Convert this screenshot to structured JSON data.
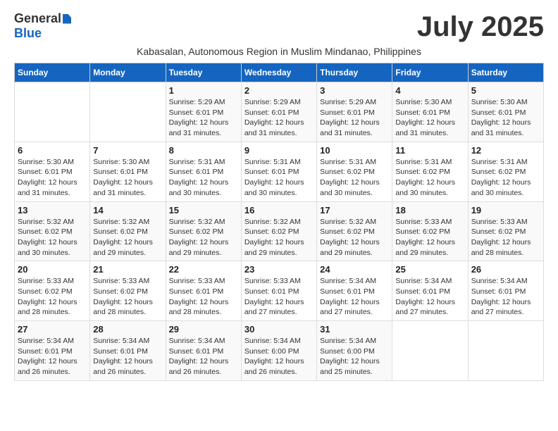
{
  "logo": {
    "general": "General",
    "blue": "Blue"
  },
  "title": "July 2025",
  "subtitle": "Kabasalan, Autonomous Region in Muslim Mindanao, Philippines",
  "headers": [
    "Sunday",
    "Monday",
    "Tuesday",
    "Wednesday",
    "Thursday",
    "Friday",
    "Saturday"
  ],
  "weeks": [
    [
      {
        "day": "",
        "info": ""
      },
      {
        "day": "",
        "info": ""
      },
      {
        "day": "1",
        "info": "Sunrise: 5:29 AM\nSunset: 6:01 PM\nDaylight: 12 hours and 31 minutes."
      },
      {
        "day": "2",
        "info": "Sunrise: 5:29 AM\nSunset: 6:01 PM\nDaylight: 12 hours and 31 minutes."
      },
      {
        "day": "3",
        "info": "Sunrise: 5:29 AM\nSunset: 6:01 PM\nDaylight: 12 hours and 31 minutes."
      },
      {
        "day": "4",
        "info": "Sunrise: 5:30 AM\nSunset: 6:01 PM\nDaylight: 12 hours and 31 minutes."
      },
      {
        "day": "5",
        "info": "Sunrise: 5:30 AM\nSunset: 6:01 PM\nDaylight: 12 hours and 31 minutes."
      }
    ],
    [
      {
        "day": "6",
        "info": "Sunrise: 5:30 AM\nSunset: 6:01 PM\nDaylight: 12 hours and 31 minutes."
      },
      {
        "day": "7",
        "info": "Sunrise: 5:30 AM\nSunset: 6:01 PM\nDaylight: 12 hours and 31 minutes."
      },
      {
        "day": "8",
        "info": "Sunrise: 5:31 AM\nSunset: 6:01 PM\nDaylight: 12 hours and 30 minutes."
      },
      {
        "day": "9",
        "info": "Sunrise: 5:31 AM\nSunset: 6:01 PM\nDaylight: 12 hours and 30 minutes."
      },
      {
        "day": "10",
        "info": "Sunrise: 5:31 AM\nSunset: 6:02 PM\nDaylight: 12 hours and 30 minutes."
      },
      {
        "day": "11",
        "info": "Sunrise: 5:31 AM\nSunset: 6:02 PM\nDaylight: 12 hours and 30 minutes."
      },
      {
        "day": "12",
        "info": "Sunrise: 5:31 AM\nSunset: 6:02 PM\nDaylight: 12 hours and 30 minutes."
      }
    ],
    [
      {
        "day": "13",
        "info": "Sunrise: 5:32 AM\nSunset: 6:02 PM\nDaylight: 12 hours and 30 minutes."
      },
      {
        "day": "14",
        "info": "Sunrise: 5:32 AM\nSunset: 6:02 PM\nDaylight: 12 hours and 29 minutes."
      },
      {
        "day": "15",
        "info": "Sunrise: 5:32 AM\nSunset: 6:02 PM\nDaylight: 12 hours and 29 minutes."
      },
      {
        "day": "16",
        "info": "Sunrise: 5:32 AM\nSunset: 6:02 PM\nDaylight: 12 hours and 29 minutes."
      },
      {
        "day": "17",
        "info": "Sunrise: 5:32 AM\nSunset: 6:02 PM\nDaylight: 12 hours and 29 minutes."
      },
      {
        "day": "18",
        "info": "Sunrise: 5:33 AM\nSunset: 6:02 PM\nDaylight: 12 hours and 29 minutes."
      },
      {
        "day": "19",
        "info": "Sunrise: 5:33 AM\nSunset: 6:02 PM\nDaylight: 12 hours and 28 minutes."
      }
    ],
    [
      {
        "day": "20",
        "info": "Sunrise: 5:33 AM\nSunset: 6:02 PM\nDaylight: 12 hours and 28 minutes."
      },
      {
        "day": "21",
        "info": "Sunrise: 5:33 AM\nSunset: 6:02 PM\nDaylight: 12 hours and 28 minutes."
      },
      {
        "day": "22",
        "info": "Sunrise: 5:33 AM\nSunset: 6:01 PM\nDaylight: 12 hours and 28 minutes."
      },
      {
        "day": "23",
        "info": "Sunrise: 5:33 AM\nSunset: 6:01 PM\nDaylight: 12 hours and 27 minutes."
      },
      {
        "day": "24",
        "info": "Sunrise: 5:34 AM\nSunset: 6:01 PM\nDaylight: 12 hours and 27 minutes."
      },
      {
        "day": "25",
        "info": "Sunrise: 5:34 AM\nSunset: 6:01 PM\nDaylight: 12 hours and 27 minutes."
      },
      {
        "day": "26",
        "info": "Sunrise: 5:34 AM\nSunset: 6:01 PM\nDaylight: 12 hours and 27 minutes."
      }
    ],
    [
      {
        "day": "27",
        "info": "Sunrise: 5:34 AM\nSunset: 6:01 PM\nDaylight: 12 hours and 26 minutes."
      },
      {
        "day": "28",
        "info": "Sunrise: 5:34 AM\nSunset: 6:01 PM\nDaylight: 12 hours and 26 minutes."
      },
      {
        "day": "29",
        "info": "Sunrise: 5:34 AM\nSunset: 6:01 PM\nDaylight: 12 hours and 26 minutes."
      },
      {
        "day": "30",
        "info": "Sunrise: 5:34 AM\nSunset: 6:00 PM\nDaylight: 12 hours and 26 minutes."
      },
      {
        "day": "31",
        "info": "Sunrise: 5:34 AM\nSunset: 6:00 PM\nDaylight: 12 hours and 25 minutes."
      },
      {
        "day": "",
        "info": ""
      },
      {
        "day": "",
        "info": ""
      }
    ]
  ]
}
